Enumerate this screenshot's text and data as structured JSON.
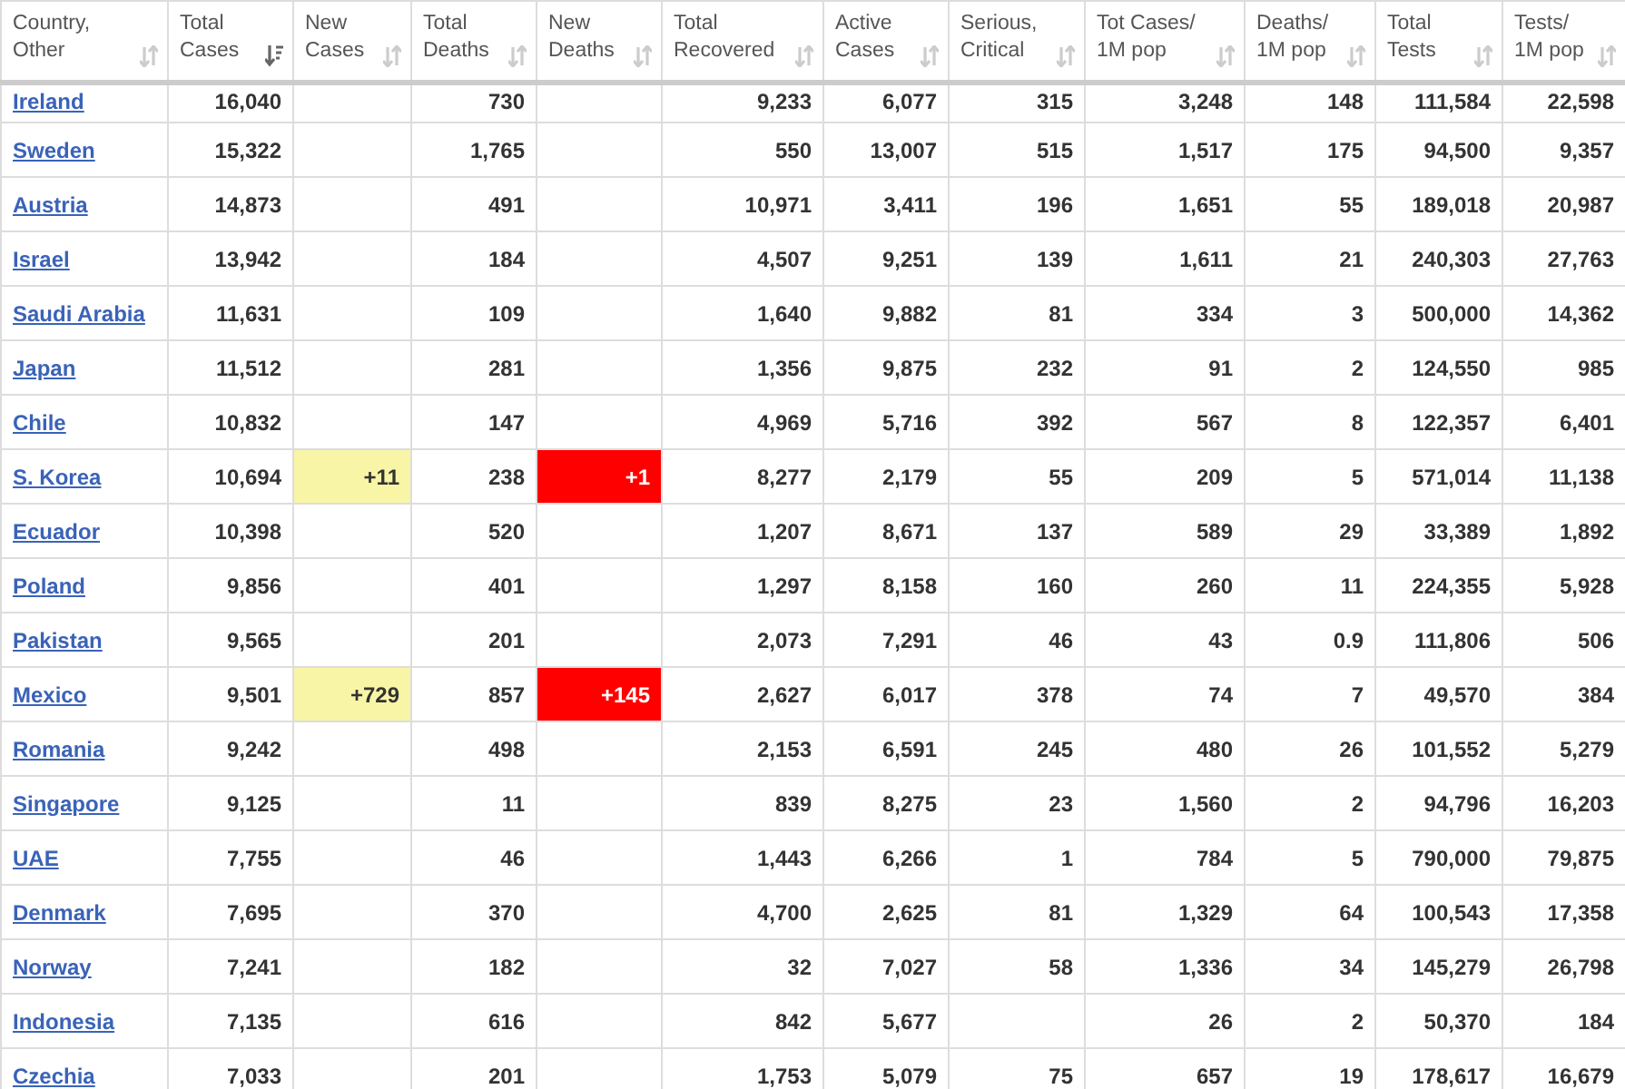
{
  "table": {
    "columns": [
      {
        "label": "Country, Other",
        "sorted": false
      },
      {
        "label": "Total Cases",
        "sorted": true
      },
      {
        "label": "New Cases",
        "sorted": false
      },
      {
        "label": "Total Deaths",
        "sorted": false
      },
      {
        "label": "New Deaths",
        "sorted": false
      },
      {
        "label": "Total Recovered",
        "sorted": false
      },
      {
        "label": "Active Cases",
        "sorted": false
      },
      {
        "label": "Serious, Critical",
        "sorted": false
      },
      {
        "label": "Tot Cases/ 1M pop",
        "sorted": false
      },
      {
        "label": "Deaths/ 1M pop",
        "sorted": false
      },
      {
        "label": "Total Tests",
        "sorted": false
      },
      {
        "label": "Tests/ 1M pop",
        "sorted": false
      }
    ],
    "rows": [
      {
        "country": "Ireland",
        "total_cases": "16,040",
        "total_deaths": "730",
        "total_recovered": "9,233",
        "active_cases": "6,077",
        "serious_critical": "315",
        "cases_per_1m": "3,248",
        "deaths_per_1m": "148",
        "total_tests": "111,584",
        "tests_per_1m": "22,598"
      },
      {
        "country": "Sweden",
        "total_cases": "15,322",
        "total_deaths": "1,765",
        "total_recovered": "550",
        "active_cases": "13,007",
        "serious_critical": "515",
        "cases_per_1m": "1,517",
        "deaths_per_1m": "175",
        "total_tests": "94,500",
        "tests_per_1m": "9,357"
      },
      {
        "country": "Austria",
        "total_cases": "14,873",
        "total_deaths": "491",
        "total_recovered": "10,971",
        "active_cases": "3,411",
        "serious_critical": "196",
        "cases_per_1m": "1,651",
        "deaths_per_1m": "55",
        "total_tests": "189,018",
        "tests_per_1m": "20,987"
      },
      {
        "country": "Israel",
        "total_cases": "13,942",
        "total_deaths": "184",
        "total_recovered": "4,507",
        "active_cases": "9,251",
        "serious_critical": "139",
        "cases_per_1m": "1,611",
        "deaths_per_1m": "21",
        "total_tests": "240,303",
        "tests_per_1m": "27,763"
      },
      {
        "country": "Saudi Arabia",
        "total_cases": "11,631",
        "total_deaths": "109",
        "total_recovered": "1,640",
        "active_cases": "9,882",
        "serious_critical": "81",
        "cases_per_1m": "334",
        "deaths_per_1m": "3",
        "total_tests": "500,000",
        "tests_per_1m": "14,362"
      },
      {
        "country": "Japan",
        "total_cases": "11,512",
        "total_deaths": "281",
        "total_recovered": "1,356",
        "active_cases": "9,875",
        "serious_critical": "232",
        "cases_per_1m": "91",
        "deaths_per_1m": "2",
        "total_tests": "124,550",
        "tests_per_1m": "985"
      },
      {
        "country": "Chile",
        "total_cases": "10,832",
        "total_deaths": "147",
        "total_recovered": "4,969",
        "active_cases": "5,716",
        "serious_critical": "392",
        "cases_per_1m": "567",
        "deaths_per_1m": "8",
        "total_tests": "122,357",
        "tests_per_1m": "6,401"
      },
      {
        "country": "S. Korea",
        "total_cases": "10,694",
        "new_cases": "+11",
        "total_deaths": "238",
        "new_deaths": "+1",
        "total_recovered": "8,277",
        "active_cases": "2,179",
        "serious_critical": "55",
        "cases_per_1m": "209",
        "deaths_per_1m": "5",
        "total_tests": "571,014",
        "tests_per_1m": "11,138"
      },
      {
        "country": "Ecuador",
        "total_cases": "10,398",
        "total_deaths": "520",
        "total_recovered": "1,207",
        "active_cases": "8,671",
        "serious_critical": "137",
        "cases_per_1m": "589",
        "deaths_per_1m": "29",
        "total_tests": "33,389",
        "tests_per_1m": "1,892"
      },
      {
        "country": "Poland",
        "total_cases": "9,856",
        "total_deaths": "401",
        "total_recovered": "1,297",
        "active_cases": "8,158",
        "serious_critical": "160",
        "cases_per_1m": "260",
        "deaths_per_1m": "11",
        "total_tests": "224,355",
        "tests_per_1m": "5,928"
      },
      {
        "country": "Pakistan",
        "total_cases": "9,565",
        "total_deaths": "201",
        "total_recovered": "2,073",
        "active_cases": "7,291",
        "serious_critical": "46",
        "cases_per_1m": "43",
        "deaths_per_1m": "0.9",
        "total_tests": "111,806",
        "tests_per_1m": "506"
      },
      {
        "country": "Mexico",
        "total_cases": "9,501",
        "new_cases": "+729",
        "total_deaths": "857",
        "new_deaths": "+145",
        "total_recovered": "2,627",
        "active_cases": "6,017",
        "serious_critical": "378",
        "cases_per_1m": "74",
        "deaths_per_1m": "7",
        "total_tests": "49,570",
        "tests_per_1m": "384"
      },
      {
        "country": "Romania",
        "total_cases": "9,242",
        "total_deaths": "498",
        "total_recovered": "2,153",
        "active_cases": "6,591",
        "serious_critical": "245",
        "cases_per_1m": "480",
        "deaths_per_1m": "26",
        "total_tests": "101,552",
        "tests_per_1m": "5,279"
      },
      {
        "country": "Singapore",
        "total_cases": "9,125",
        "total_deaths": "11",
        "total_recovered": "839",
        "active_cases": "8,275",
        "serious_critical": "23",
        "cases_per_1m": "1,560",
        "deaths_per_1m": "2",
        "total_tests": "94,796",
        "tests_per_1m": "16,203"
      },
      {
        "country": "UAE",
        "total_cases": "7,755",
        "total_deaths": "46",
        "total_recovered": "1,443",
        "active_cases": "6,266",
        "serious_critical": "1",
        "cases_per_1m": "784",
        "deaths_per_1m": "5",
        "total_tests": "790,000",
        "tests_per_1m": "79,875"
      },
      {
        "country": "Denmark",
        "total_cases": "7,695",
        "total_deaths": "370",
        "total_recovered": "4,700",
        "active_cases": "2,625",
        "serious_critical": "81",
        "cases_per_1m": "1,329",
        "deaths_per_1m": "64",
        "total_tests": "100,543",
        "tests_per_1m": "17,358"
      },
      {
        "country": "Norway",
        "total_cases": "7,241",
        "total_deaths": "182",
        "total_recovered": "32",
        "active_cases": "7,027",
        "serious_critical": "58",
        "cases_per_1m": "1,336",
        "deaths_per_1m": "34",
        "total_tests": "145,279",
        "tests_per_1m": "26,798"
      },
      {
        "country": "Indonesia",
        "total_cases": "7,135",
        "total_deaths": "616",
        "total_recovered": "842",
        "active_cases": "5,677",
        "cases_per_1m": "26",
        "deaths_per_1m": "2",
        "total_tests": "50,370",
        "tests_per_1m": "184"
      },
      {
        "country": "Czechia",
        "total_cases": "7,033",
        "total_deaths": "201",
        "total_recovered": "1,753",
        "active_cases": "5,079",
        "serious_critical": "75",
        "cases_per_1m": "657",
        "deaths_per_1m": "19",
        "total_tests": "178,617",
        "tests_per_1m": "16,679"
      }
    ]
  }
}
